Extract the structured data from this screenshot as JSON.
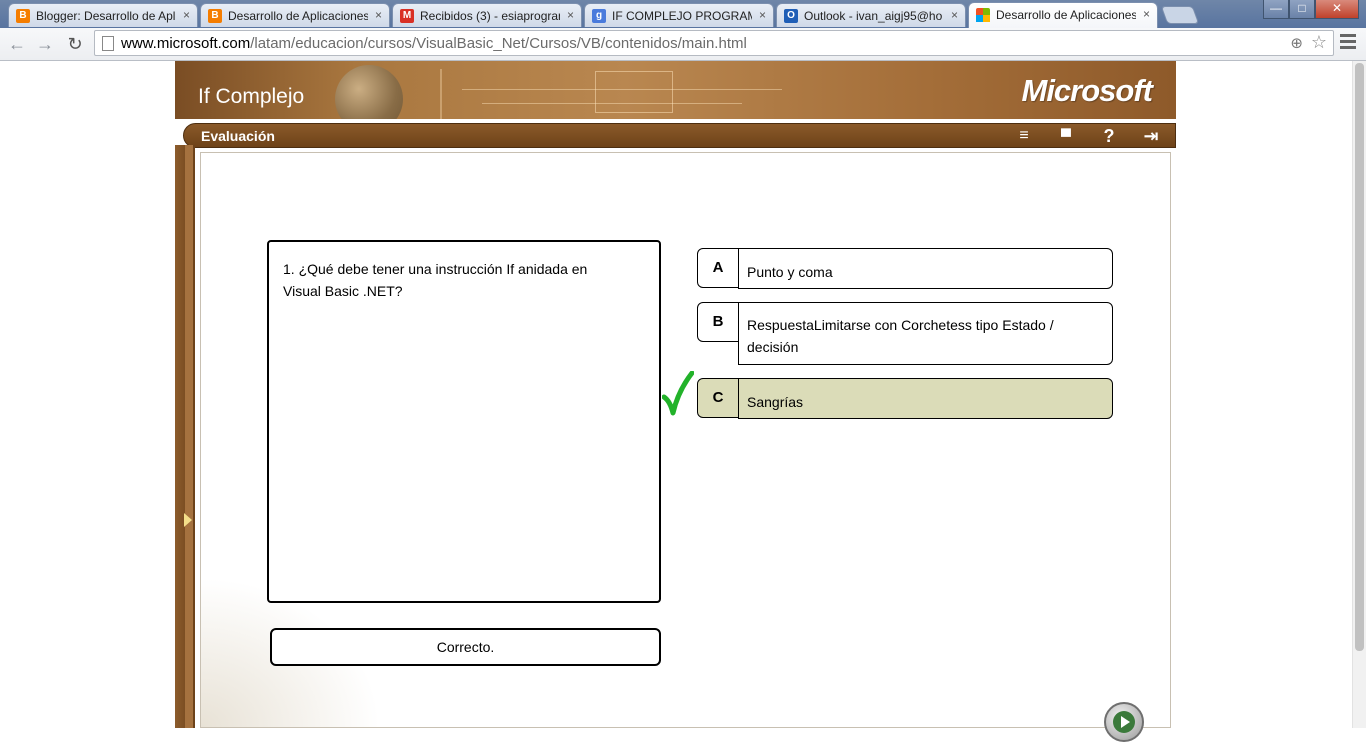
{
  "browser": {
    "tabs": [
      {
        "title": "Blogger: Desarrollo de Apl",
        "icon": "blogger-icon",
        "color": "#f57d00",
        "glyph": "B",
        "active": false
      },
      {
        "title": "Desarrollo de Aplicaciones",
        "icon": "blogger-icon",
        "color": "#f57d00",
        "glyph": "B",
        "active": false
      },
      {
        "title": "Recibidos (3) - esiaprogran",
        "icon": "gmail-icon",
        "color": "#d93025",
        "glyph": "M",
        "active": false
      },
      {
        "title": "IF COMPLEJO PROGRAMA",
        "icon": "google-icon",
        "color": "#4a7bdc",
        "glyph": "g",
        "active": false
      },
      {
        "title": "Outlook - ivan_aigj95@ho",
        "icon": "outlook-icon",
        "color": "#1f5eb6",
        "glyph": "O",
        "active": false
      },
      {
        "title": "Desarrollo de Aplicaciones",
        "icon": "microsoft-icon",
        "color": "#f25022",
        "glyph": "",
        "active": true
      }
    ],
    "tab_close_glyph": "×",
    "window_buttons": {
      "minimize": "—",
      "maximize": "□",
      "close": "✕"
    },
    "url_host": "www.microsoft.com",
    "url_path": "/latam/educacion/cursos/VisualBasic_Net/Cursos/VB/contenidos/main.html",
    "nav": {
      "back": "←",
      "forward": "→",
      "reload": "↻"
    }
  },
  "page": {
    "module_title": "If Complejo",
    "brand": "Microsoft",
    "section_title": "Evaluación",
    "toolbar_icons": [
      {
        "name": "glossary-icon",
        "glyph": "≡"
      },
      {
        "name": "sitemap-icon",
        "glyph": "▀"
      },
      {
        "name": "help-icon",
        "glyph": "?"
      },
      {
        "name": "exit-icon",
        "glyph": "⇥"
      }
    ],
    "question": "1. ¿Qué debe tener una instrucción If anidada en Visual Basic .NET?",
    "feedback": "Correcto.",
    "options": [
      {
        "letter": "A",
        "text": "Punto y coma",
        "selected": false
      },
      {
        "letter": "B",
        "text": "RespuestaLimitarse con Corchetess tipo Estado / decisión",
        "selected": false
      },
      {
        "letter": "C",
        "text": "Sangrías",
        "selected": true
      }
    ],
    "check_color": "#22b22a"
  }
}
